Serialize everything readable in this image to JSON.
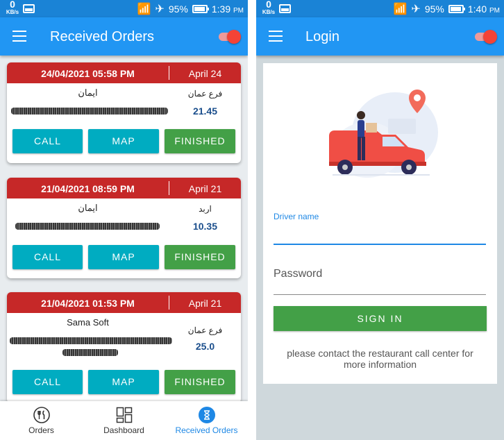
{
  "status_left": {
    "kbs_value": "0",
    "kbs_unit": "KB/s",
    "battery": "95%",
    "time": "1:39",
    "ampm": "PM"
  },
  "status_right": {
    "kbs_value": "0",
    "kbs_unit": "KB/s",
    "battery": "95%",
    "time": "1:40",
    "ampm": "PM"
  },
  "orders_screen": {
    "title": "Received Orders",
    "orders": [
      {
        "datetime": "24/04/2021 05:58 PM",
        "day": "April 24",
        "customer": "ايمان",
        "branch": "فرع عمان",
        "amount": "21.45"
      },
      {
        "datetime": "21/04/2021 08:59 PM",
        "day": "April 21",
        "customer": "ايمان",
        "branch": "اربد",
        "amount": "10.35"
      },
      {
        "datetime": "21/04/2021 01:53 PM",
        "day": "April 21",
        "customer": "Sama Soft",
        "branch": "فرع عمان",
        "amount": "25.0"
      }
    ],
    "buttons": {
      "call": "CALL",
      "map": "MAP",
      "finished": "FINISHED"
    },
    "nav": [
      {
        "label": "Orders",
        "icon": "cutlery-icon"
      },
      {
        "label": "Dashboard",
        "icon": "dashboard-icon"
      },
      {
        "label": "Received Orders",
        "icon": "hourglass-icon"
      }
    ]
  },
  "login_screen": {
    "title": "Login",
    "driver_label": "Driver name",
    "password_placeholder": "Password",
    "sign_in": "SIGN IN",
    "contact_text": "please contact the restaurant call center for more information"
  },
  "colors": {
    "appbar": "#2196f3",
    "statusbar": "#1a83d6",
    "card_header": "#c62828",
    "cyan_button": "#00acc1",
    "green_button": "#43a047",
    "amount": "#1a4e8c",
    "active_nav": "#1e88e5"
  }
}
